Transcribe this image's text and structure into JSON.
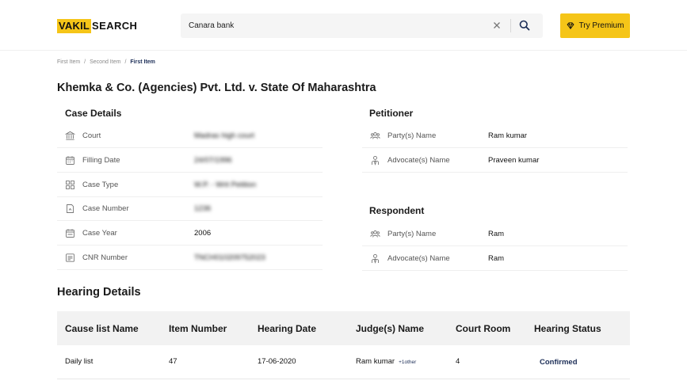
{
  "brand": {
    "logo_part1": "VAKIL",
    "logo_part2": "SEARCH",
    "accent": "#f5c518",
    "navy": "#1c2e57"
  },
  "search": {
    "value": "Canara bank",
    "placeholder": ""
  },
  "header": {
    "premium_label": "Try Premium"
  },
  "breadcrumb": [
    "First Item",
    "Second Item",
    "First Item"
  ],
  "page_title": "Khemka & Co. (Agencies) Pvt. Ltd. v. State Of Maharashtra",
  "case_details": {
    "title": "Case Details",
    "rows": [
      {
        "icon": "court-icon",
        "label": "Court",
        "value": "Madras high court"
      },
      {
        "icon": "calendar-icon",
        "label": "Filling Date",
        "value": "24/07/1996"
      },
      {
        "icon": "grid-icon",
        "label": "Case Type",
        "value": "W.P. - Writ Petition"
      },
      {
        "icon": "document-icon",
        "label": "Case Number",
        "value": "1236"
      },
      {
        "icon": "calendar-year-icon",
        "label": "Case Year",
        "value": "2006"
      },
      {
        "icon": "id-card-icon",
        "label": "CNR Number",
        "value": "TNCH010209752023"
      }
    ]
  },
  "petitioner": {
    "title": "Petitioner",
    "rows": [
      {
        "icon": "people-icon",
        "label": "Party(s) Name",
        "value": "Ram kumar"
      },
      {
        "icon": "advocate-icon",
        "label": "Advocate(s) Name",
        "value": "Praveen kumar"
      }
    ]
  },
  "respondent": {
    "title": "Respondent",
    "rows": [
      {
        "icon": "people-icon",
        "label": "Party(s) Name",
        "value": "Ram"
      },
      {
        "icon": "advocate-icon",
        "label": "Advocate(s) Name",
        "value": "Ram"
      }
    ]
  },
  "hearing": {
    "title": "Hearing Details",
    "columns": [
      "Cause list Name",
      "Item Number",
      "Hearing Date",
      "Judge(s) Name",
      "Court Room",
      "Hearing Status"
    ],
    "rows": [
      {
        "cause_list": "Daily list",
        "item_number": "47",
        "hearing_date": "17-06-2020",
        "judge": "Ram kumar",
        "judge_more": "+1other",
        "court_room": "4",
        "status": "Confirmed"
      }
    ]
  }
}
